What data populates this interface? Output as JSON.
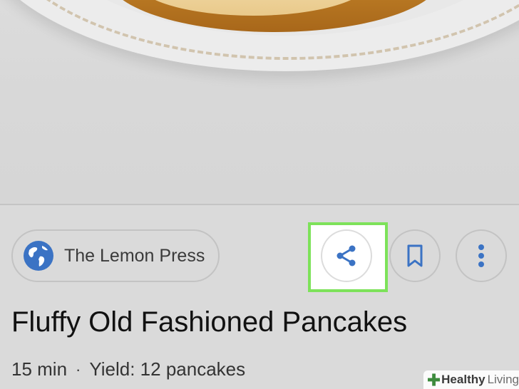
{
  "source": {
    "name": "The Lemon Press",
    "icon": "globe-icon",
    "icon_color": "#3b73c4"
  },
  "actions": {
    "share_icon": "share-icon",
    "bookmark_icon": "bookmark-icon",
    "more_icon": "more-vert-icon",
    "accent_color": "#3b73c4",
    "highlight_color": "#7de25a"
  },
  "recipe": {
    "title": "Fluffy Old Fashioned Pancakes",
    "time": "15 min",
    "separator": "·",
    "yield": "Yield: 12 pancakes"
  },
  "watermark": {
    "brand_a": "Healthy",
    "brand_b": "Living",
    "icon": "cross-logo"
  }
}
